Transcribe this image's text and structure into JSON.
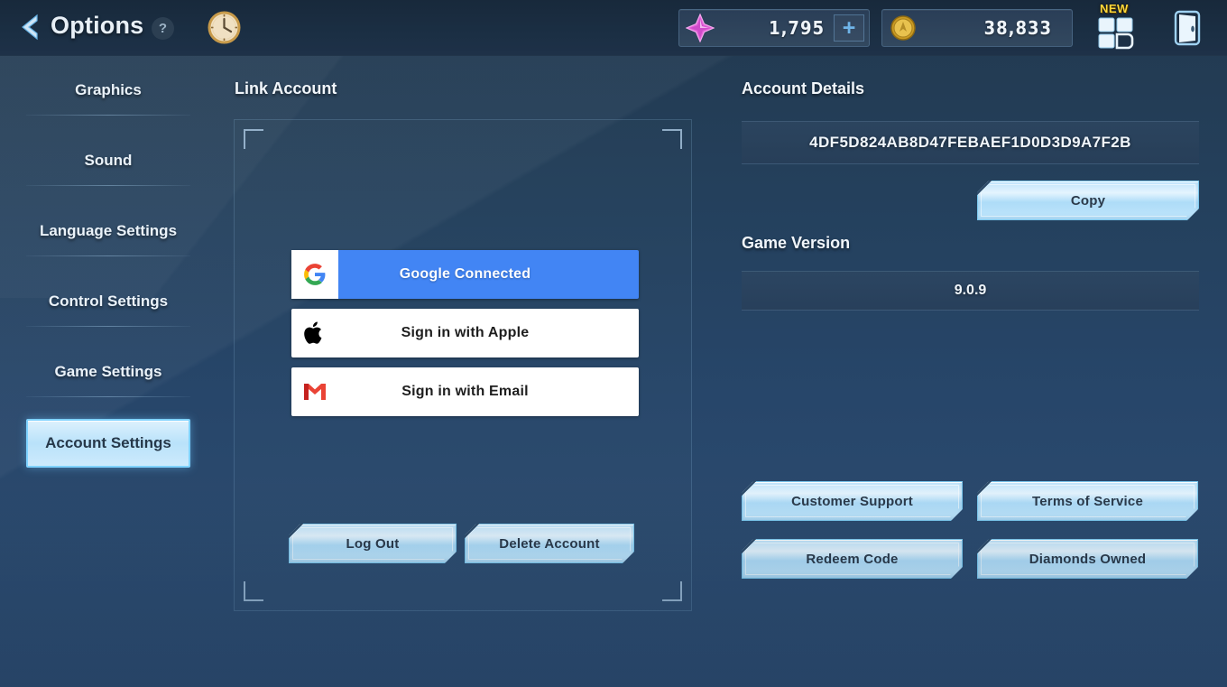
{
  "header": {
    "title": "Options",
    "help_label": "?",
    "back_icon": "back-chevron-icon",
    "clock_icon": "clock-icon",
    "currencies": [
      {
        "icon": "diamond-icon",
        "value": "1,795",
        "add_label": "+"
      },
      {
        "icon": "gold-coin-icon",
        "value": "38,833"
      }
    ],
    "grid_icon": "grid-menu-icon",
    "new_badge": "NEW",
    "exit_icon": "door-exit-icon"
  },
  "sidebar": {
    "items": [
      {
        "label": "Graphics",
        "active": false
      },
      {
        "label": "Sound",
        "active": false
      },
      {
        "label": "Language Settings",
        "active": false
      },
      {
        "label": "Control Settings",
        "active": false
      },
      {
        "label": "Game Settings",
        "active": false
      },
      {
        "label": "Account Settings",
        "active": true
      }
    ]
  },
  "link_account": {
    "heading": "Link Account",
    "providers": [
      {
        "id": "google",
        "icon": "google-g-icon",
        "label": "Google Connected",
        "connected": true
      },
      {
        "id": "apple",
        "icon": "apple-logo-icon",
        "label": "Sign in with Apple",
        "connected": false
      },
      {
        "id": "email",
        "icon": "gmail-m-icon",
        "label": "Sign in with Email",
        "connected": false
      }
    ],
    "log_out_label": "Log Out",
    "delete_account_label": "Delete Account"
  },
  "account_details": {
    "heading": "Account Details",
    "account_id": "4DF5D824AB8D47FEBAEF1D0D3D9A7F2B",
    "copy_label": "Copy"
  },
  "game_version": {
    "heading": "Game Version",
    "value": "9.0.9"
  },
  "actions": {
    "customer_support": "Customer Support",
    "terms_of_service": "Terms of Service",
    "redeem_code": "Redeem Code",
    "diamonds_owned": "Diamonds Owned"
  },
  "colors": {
    "accent_cyan": "#7fd2ff",
    "google_blue": "#4285f4",
    "badge_yellow": "#ffd93b",
    "background_dark": "#22394f"
  }
}
